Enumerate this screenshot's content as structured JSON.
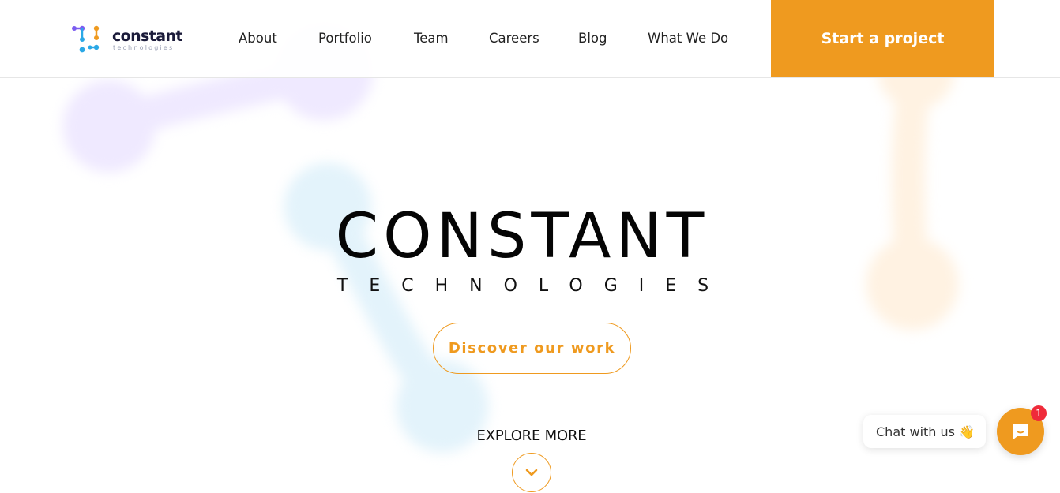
{
  "header": {
    "logo_word": "constant",
    "logo_sub": "technologies",
    "nav": [
      "About",
      "Portfolio",
      "Team",
      "Careers",
      "Blog",
      "What We Do"
    ],
    "cta_label": "Start a project"
  },
  "hero": {
    "title": "CONSTANT",
    "subtitle": "TECHNOLOGIES",
    "discover_label": "Discover our work",
    "explore_label": "EXPLORE MORE"
  },
  "chat": {
    "label": "Chat with us",
    "wave_icon": "👋",
    "badge_count": "1"
  },
  "colors": {
    "accent": "#ef9a1f",
    "badge": "#ef2b3a",
    "logo_purple": "#7b5cf0",
    "logo_blue": "#2aa8e6",
    "logo_orange": "#ef9a1f"
  },
  "icons": {
    "explore": "chevron-down-icon",
    "chat_launcher": "chat-icon"
  }
}
